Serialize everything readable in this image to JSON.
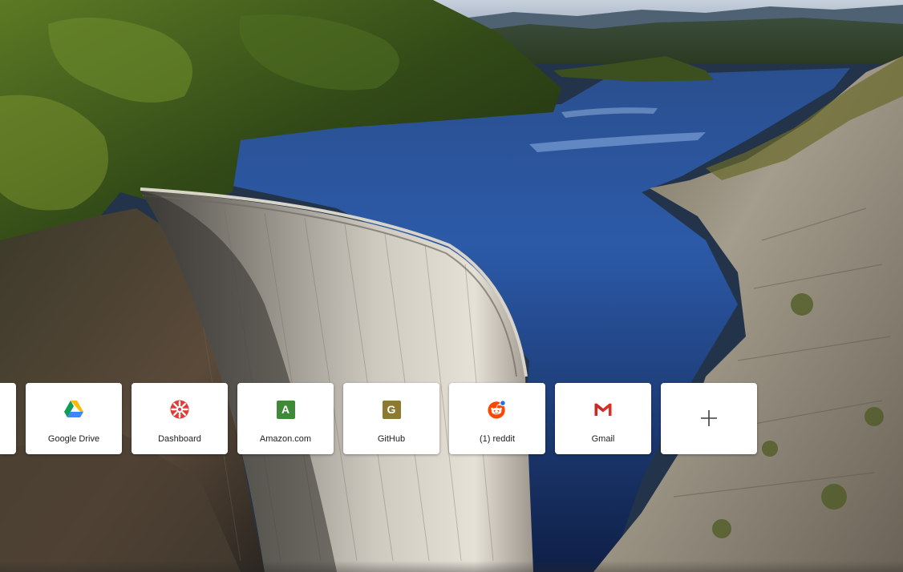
{
  "background": {
    "description_icon": "dam-landscape-wallpaper",
    "colors": {
      "sky": "#9fb2c6",
      "water": "#1d3a78",
      "forest": "#3f5a1c",
      "rock": "#8c8375",
      "dam": "#b9b6ad"
    }
  },
  "shortcuts": [
    {
      "label": "",
      "icon": "partial-tile"
    },
    {
      "label": "Google Drive",
      "icon": "google-drive-icon"
    },
    {
      "label": "Dashboard",
      "icon": "dashboard-icon",
      "color": "#e53935"
    },
    {
      "label": "Amazon.com",
      "icon": "amazon-icon",
      "letter": "A",
      "color": "#3f8a38"
    },
    {
      "label": "GitHub",
      "icon": "github-icon",
      "letter": "G",
      "color": "#8b7a2f"
    },
    {
      "label": "(1) reddit",
      "icon": "reddit-icon",
      "color": "#ff4500"
    },
    {
      "label": "Gmail",
      "icon": "gmail-icon",
      "color": "#d93025"
    },
    {
      "label": "",
      "icon": "add-shortcut-icon"
    }
  ]
}
